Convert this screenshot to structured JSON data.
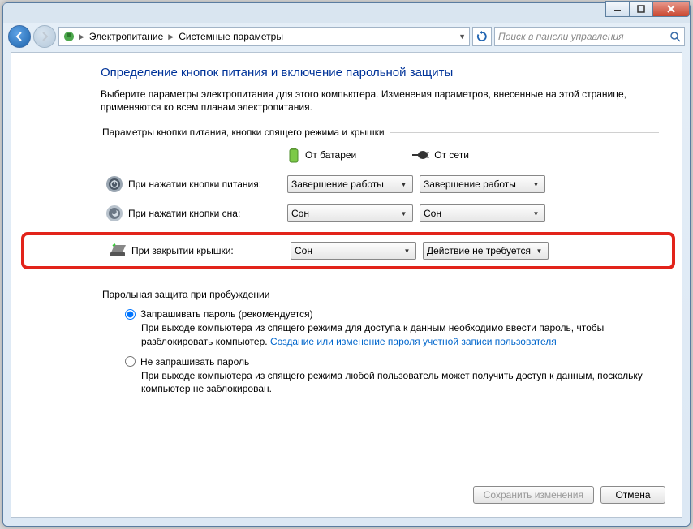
{
  "breadcrumb": {
    "item1": "Электропитание",
    "item2": "Системные параметры"
  },
  "search": {
    "placeholder": "Поиск в панели управления"
  },
  "page": {
    "title": "Определение кнопок питания и включение парольной защиты",
    "intro": "Выберите параметры электропитания для этого компьютера. Изменения параметров, внесенные на этой странице, применяются ко всем планам электропитания."
  },
  "section_buttons": {
    "legend": "Параметры кнопки питания, кнопки спящего режима и крышки",
    "col_battery": "От батареи",
    "col_ac": "От сети",
    "rows": {
      "power": {
        "label": "При нажатии кнопки питания:",
        "battery": "Завершение работы",
        "ac": "Завершение работы"
      },
      "sleep": {
        "label": "При нажатии кнопки сна:",
        "battery": "Сон",
        "ac": "Сон"
      },
      "lid": {
        "label": "При закрытии крышки:",
        "battery": "Сон",
        "ac": "Действие не требуется"
      }
    }
  },
  "section_password": {
    "legend": "Парольная защита при пробуждении",
    "opt_require": {
      "label": "Запрашивать пароль (рекомендуется)",
      "desc_pre": "При выходе компьютера из спящего режима для доступа к данным необходимо ввести пароль, чтобы разблокировать компьютер. ",
      "link": "Создание или изменение пароля учетной записи пользователя"
    },
    "opt_norequire": {
      "label": "Не запрашивать пароль",
      "desc": "При выходе компьютера из спящего режима любой пользователь может получить доступ к данным, поскольку компьютер не заблокирован."
    }
  },
  "buttons": {
    "save": "Сохранить изменения",
    "cancel": "Отмена"
  }
}
